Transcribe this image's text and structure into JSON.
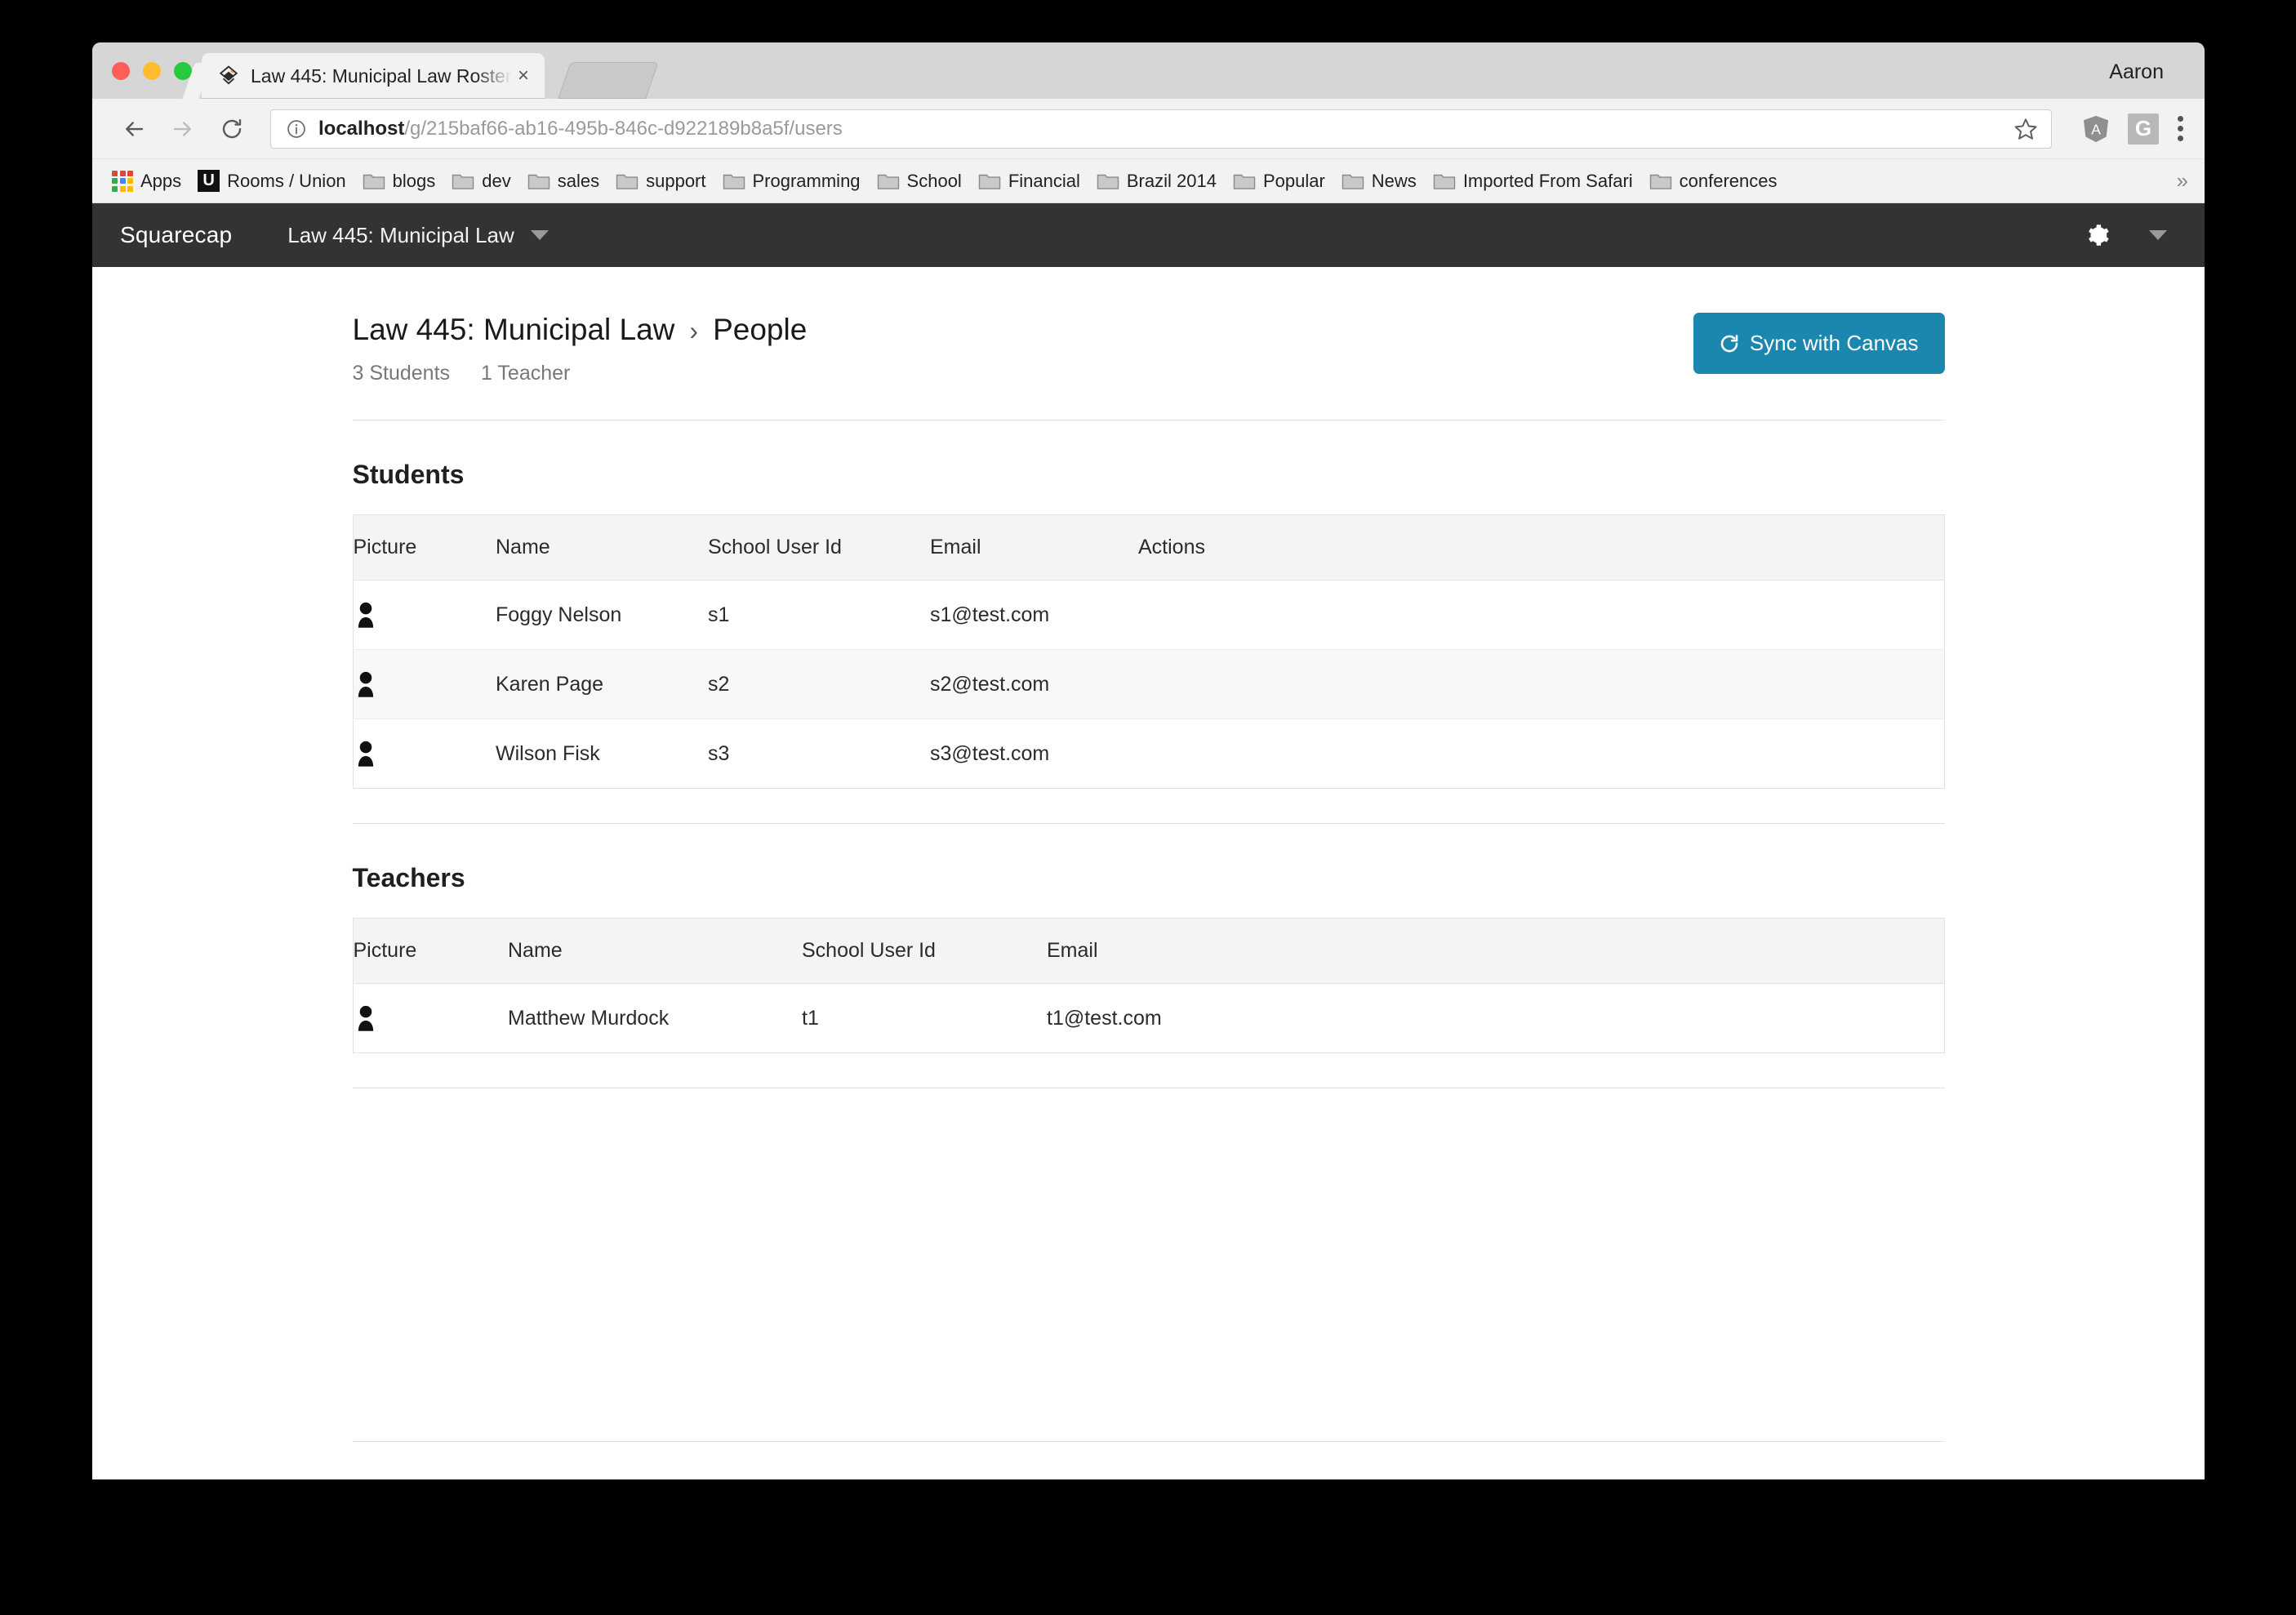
{
  "browser": {
    "profile_name": "Aaron",
    "tab": {
      "title": "Law 445: Municipal Law Roster",
      "close_label": "×",
      "favicon_name": "squarecap-diamond-favicon"
    },
    "omnibox": {
      "url_host": "localhost",
      "url_path": "/g/215baf66-ab16-495b-846c-d922189b8a5f/users"
    },
    "bookmarks": [
      {
        "label": "Apps",
        "icon": "apps-grid-icon"
      },
      {
        "label": "Rooms / Union",
        "icon": "u-favicon-icon"
      },
      {
        "label": "blogs",
        "icon": "folder-icon"
      },
      {
        "label": "dev",
        "icon": "folder-icon"
      },
      {
        "label": "sales",
        "icon": "folder-icon"
      },
      {
        "label": "support",
        "icon": "folder-icon"
      },
      {
        "label": "Programming",
        "icon": "folder-icon"
      },
      {
        "label": "School",
        "icon": "folder-icon"
      },
      {
        "label": "Financial",
        "icon": "folder-icon"
      },
      {
        "label": "Brazil 2014",
        "icon": "folder-icon"
      },
      {
        "label": "Popular",
        "icon": "folder-icon"
      },
      {
        "label": "News",
        "icon": "folder-icon"
      },
      {
        "label": "Imported From Safari",
        "icon": "folder-icon"
      },
      {
        "label": "conferences",
        "icon": "folder-icon"
      }
    ],
    "bookmarks_overflow": "»",
    "extensions": [
      {
        "name": "angular-extension-icon",
        "label": "A"
      },
      {
        "name": "google-extension-icon",
        "label": "G"
      }
    ]
  },
  "appbar": {
    "brand": "Squarecap",
    "course": "Law 445: Municipal Law",
    "gear_label": "settings",
    "accent": "#333333"
  },
  "page": {
    "breadcrumb_course": "Law 445: Municipal Law",
    "breadcrumb_separator": "›",
    "breadcrumb_page": "People",
    "student_count": "3 Students",
    "teacher_count": "1 Teacher",
    "sync_button": "Sync with Canvas",
    "sync_button_color": "#1b87ae"
  },
  "students": {
    "section_title": "Students",
    "columns": [
      "Picture",
      "Name",
      "School User Id",
      "Email",
      "Actions"
    ],
    "rows": [
      {
        "name": "Foggy Nelson",
        "school_user_id": "s1",
        "email": "s1@test.com",
        "actions": ""
      },
      {
        "name": "Karen Page",
        "school_user_id": "s2",
        "email": "s2@test.com",
        "actions": ""
      },
      {
        "name": "Wilson Fisk",
        "school_user_id": "s3",
        "email": "s3@test.com",
        "actions": ""
      }
    ]
  },
  "teachers": {
    "section_title": "Teachers",
    "columns": [
      "Picture",
      "Name",
      "School User Id",
      "Email"
    ],
    "rows": [
      {
        "name": "Matthew Murdock",
        "school_user_id": "t1",
        "email": "t1@test.com"
      }
    ]
  }
}
